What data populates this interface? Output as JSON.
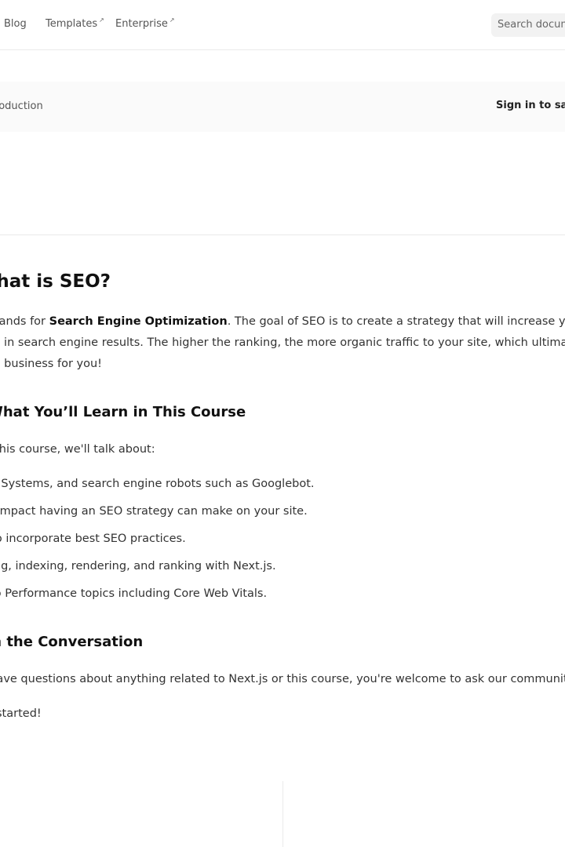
{
  "nav": {
    "links": [
      {
        "label": "Blog",
        "external": false
      },
      {
        "label": "Templates",
        "external": true
      },
      {
        "label": "Enterprise",
        "external": true
      }
    ],
    "external_glyph": "↗",
    "search_placeholder": "Search documentation..."
  },
  "course_bar": {
    "breadcrumb": "Introduction",
    "sign_in": "Sign in to save progress"
  },
  "article": {
    "title": "What is SEO?",
    "intro_pre": "SEO stands for ",
    "intro_bold": "Search Engine Optimization",
    "intro_post_line1": ". The goal of SEO is to create a strategy that will increase your rankings",
    "intro_line2": "position in search engine results. The higher the ranking, the more organic traffic to your site, which ultimately",
    "intro_line3": "more business for you!",
    "learn_heading": "What You’ll Learn in This Course",
    "learn_intro": "In this course, we'll talk about:",
    "learn_items": [
      "Search Systems, and search engine robots such as Googlebot.",
      "The impact having an SEO strategy can make on your site.",
      "How to incorporate best SEO practices.",
      "Crawling, indexing, rendering, and ranking with Next.js.",
      "Web Performance topics including Core Web Vitals."
    ],
    "convo_heading": "Join the Conversation",
    "convo_text": "If you have questions about anything related to Next.js or this course, you're welcome to ask our community on",
    "closing": "Let's get started!"
  }
}
